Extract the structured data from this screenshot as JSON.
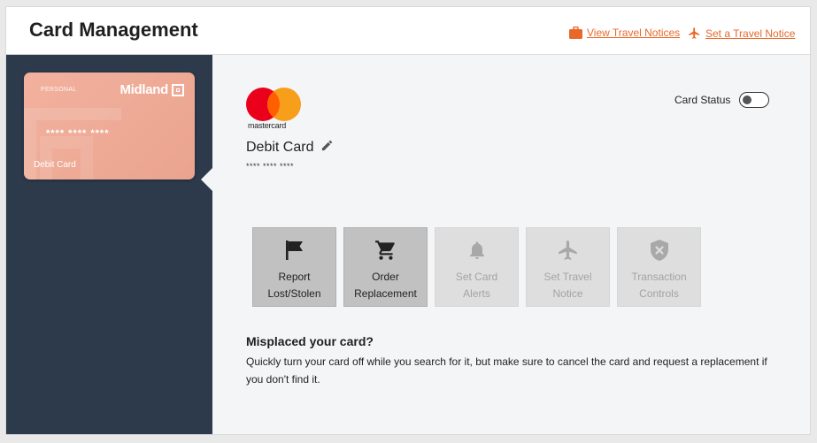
{
  "header": {
    "title": "Card Management",
    "view_travel_notices": "View Travel Notices",
    "set_travel_notice": "Set a Travel Notice",
    "accent_color": "#e8682a"
  },
  "sidebar": {
    "card": {
      "type_label": "PERSONAL",
      "brand": "Midland",
      "masked_number": "**** **** ****",
      "name": "Debit Card",
      "color": "#eea893"
    }
  },
  "detail": {
    "network_logo_text": "mastercard",
    "card_name": "Debit Card",
    "masked_number": "**** **** ****",
    "status_label": "Card Status",
    "status_on": false
  },
  "actions": [
    {
      "line1": "Report",
      "line2": "Lost/Stolen",
      "icon": "flag-icon",
      "enabled": true
    },
    {
      "line1": "Order",
      "line2": "Replacement",
      "icon": "cart-icon",
      "enabled": true
    },
    {
      "line1": "Set Card",
      "line2": "Alerts",
      "icon": "bell-icon",
      "enabled": false
    },
    {
      "line1": "Set Travel",
      "line2": "Notice",
      "icon": "airplane-icon",
      "enabled": false
    },
    {
      "line1": "Transaction",
      "line2": "Controls",
      "icon": "shield-x-icon",
      "enabled": false
    }
  ],
  "info": {
    "title": "Misplaced your card?",
    "body": "Quickly turn your card off while you search for it, but make sure to cancel the card and request a replacement if you don't find it."
  }
}
